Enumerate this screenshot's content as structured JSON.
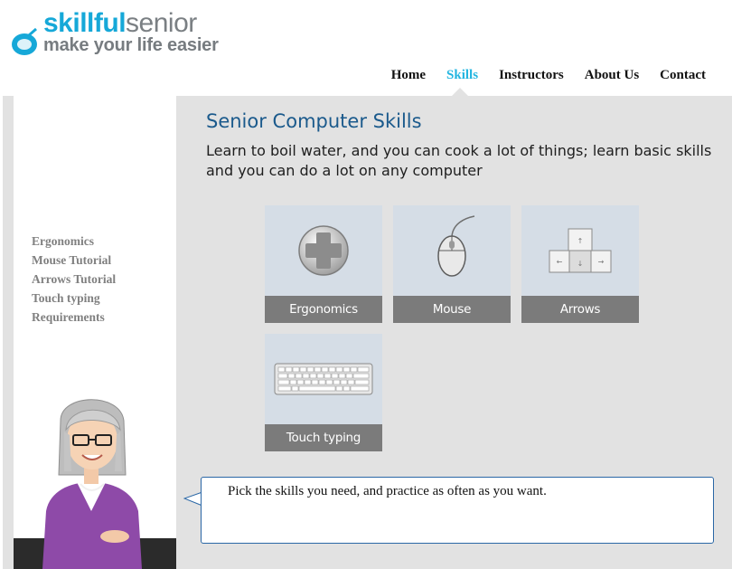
{
  "header": {
    "logo_primary": "skillful",
    "logo_secondary": "senior",
    "tagline": "make your life easier"
  },
  "nav": {
    "items": [
      "Home",
      "Skills",
      "Instructors",
      "About Us",
      "Contact"
    ],
    "active": "Skills"
  },
  "sidebar": {
    "links": [
      "Ergonomics",
      "Mouse Tutorial",
      "Arrows Tutorial",
      "Touch typing",
      "Requirements"
    ]
  },
  "main": {
    "title": "Senior Computer Skills",
    "subtitle": "Learn to boil water, and you can cook a lot of things; learn basic skills and you can do a lot on any computer",
    "tiles": [
      {
        "label": "Ergonomics",
        "icon": "plus-circle-icon"
      },
      {
        "label": "Mouse",
        "icon": "mouse-icon"
      },
      {
        "label": "Arrows",
        "icon": "arrow-keys-icon"
      },
      {
        "label": "Touch typing",
        "icon": "keyboard-icon"
      }
    ]
  },
  "bubble": {
    "text": "Pick the skills you need, and practice as often as you want."
  },
  "colors": {
    "brand_blue": "#16a8d8",
    "title_blue": "#1b5a8c",
    "panel_gray": "#e2e2e2",
    "tile_bg": "#d5dde6",
    "caption_gray": "#7b7b7b",
    "avatar_purple": "#8e4aa8"
  }
}
